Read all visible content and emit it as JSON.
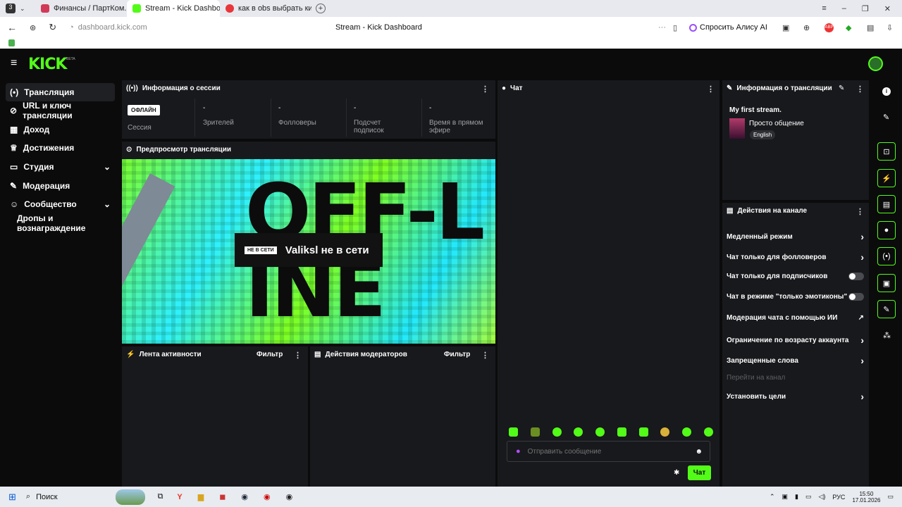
{
  "browser": {
    "tabs": [
      {
        "label": "Финансы / ПартКом. Зап",
        "color": "#d23a5a"
      },
      {
        "label": "Stream - Kick Dashboar",
        "color": "#53fc18"
      },
      {
        "label": "как в obs выбрать кик — ",
        "color": "#e8363b"
      }
    ],
    "url": "dashboard.kick.com",
    "page_title": "Stream - Kick Dashboard",
    "alice": "Спросить Алису AI"
  },
  "app": {
    "logo": "KICK",
    "logo_badge": "BETA"
  },
  "sidebar": {
    "items": [
      {
        "icon": "(•)",
        "label": "Трансляция"
      },
      {
        "icon": "⊘",
        "label": "URL и ключ трансляции"
      },
      {
        "icon": "▦",
        "label": "Доход"
      },
      {
        "icon": "♕",
        "label": "Достижения"
      },
      {
        "icon": "▭",
        "label": "Студия"
      },
      {
        "icon": "✎",
        "label": "Модерация"
      },
      {
        "icon": "☺",
        "label": "Сообщество"
      },
      {
        "icon": "",
        "label": "Дропы и вознаграждение"
      }
    ]
  },
  "session": {
    "title": "Информация о сессии",
    "status": "ОФЛАЙН",
    "session_label": "Сессия",
    "stats": [
      {
        "value": "-",
        "label": "Зрителей"
      },
      {
        "value": "-",
        "label": "Фолловеры"
      },
      {
        "value": "-",
        "label": "Подсчет подписок"
      },
      {
        "value": "-",
        "label": "Время в прямом эфире"
      }
    ]
  },
  "preview": {
    "title": "Предпросмотр трансляции",
    "art_text": "OFF-LINE",
    "badge": "НЕ В СЕТИ",
    "message": "Valiksl не в сети"
  },
  "activity": {
    "title": "Лента активности",
    "filter": "Фильтр"
  },
  "modactions": {
    "title": "Действия модераторов",
    "filter": "Фильтр"
  },
  "chat": {
    "title": "Чат",
    "placeholder": "Отправить сообщение",
    "send": "Чат"
  },
  "streaminfo": {
    "title": "Информация о трансляции",
    "stream_title": "My first stream.",
    "category": "Просто общение",
    "language": "English"
  },
  "channel_actions": {
    "title": "Действия на канале",
    "items": [
      {
        "label": "Медленный режим",
        "control": "›"
      },
      {
        "label": "Чат только для фолловеров",
        "control": "›"
      },
      {
        "label": "Чат только для подписчиков",
        "control": "toggle"
      },
      {
        "label": "Чат в режиме \"только эмотиконы\"",
        "control": "toggle"
      },
      {
        "label": "Модерация чата с помощью ИИ",
        "control": "↗"
      },
      {
        "label": "Ограничение по возрасту аккаунта",
        "control": "›"
      },
      {
        "label": "Запрещенные слова",
        "control": "›"
      },
      {
        "label": "Перейти на канал",
        "control": ""
      },
      {
        "label": "Установить цели",
        "control": "›"
      }
    ]
  },
  "taskbar": {
    "search": "Поиск",
    "lang": "РУС",
    "time": "15:50",
    "date": "17.01.2026"
  },
  "colors": {
    "accent": "#53fc18",
    "panel": "#18191c",
    "bg": "#0b0b0c"
  }
}
